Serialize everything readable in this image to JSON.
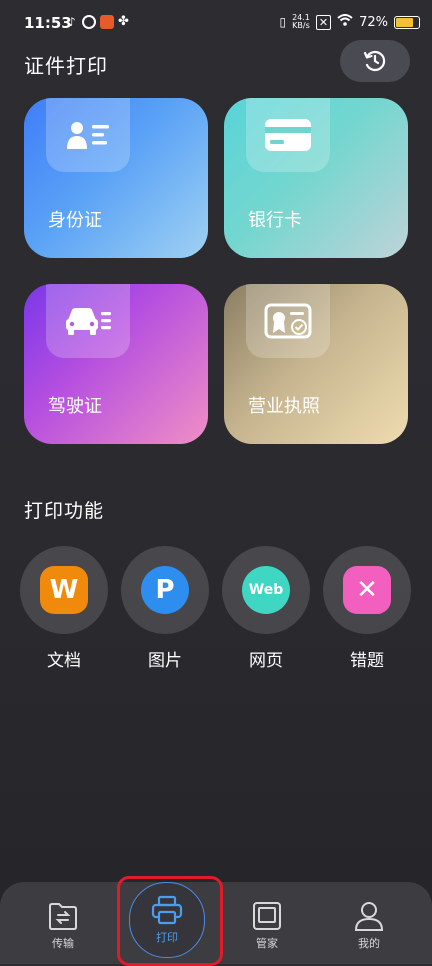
{
  "status_bar": {
    "time": "11:53",
    "net_speed_value": "24.1",
    "net_speed_unit": "KB/s",
    "battery_percent": "72%",
    "battery_level": 0.72
  },
  "header": {
    "title": "证件打印",
    "history_icon": "history-clock-icon"
  },
  "id_cards": [
    {
      "label": "身份证",
      "icon": "id-card-icon"
    },
    {
      "label": "银行卡",
      "icon": "bank-card-icon"
    },
    {
      "label": "驾驶证",
      "icon": "car-license-icon"
    },
    {
      "label": "营业执照",
      "icon": "business-license-icon"
    }
  ],
  "functions": {
    "title": "打印功能",
    "items": [
      {
        "label": "文档",
        "glyph": "W",
        "color": "#f08a0c"
      },
      {
        "label": "图片",
        "glyph": "P",
        "color": "#2d8ef0"
      },
      {
        "label": "网页",
        "glyph": "Web",
        "color": "#3fd6c3"
      },
      {
        "label": "错题",
        "glyph": "✕",
        "color": "#f25fbf"
      }
    ]
  },
  "bottom_nav": {
    "items": [
      {
        "label": "传输"
      },
      {
        "label": "打印"
      },
      {
        "label": "管家"
      },
      {
        "label": "我的"
      }
    ],
    "active": "打印",
    "highlight_color": "#e11c2a"
  }
}
